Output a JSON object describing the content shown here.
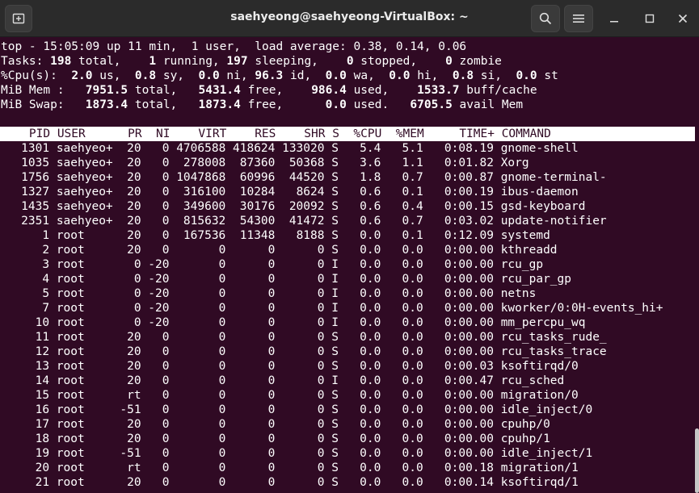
{
  "window": {
    "title": "saehyeong@saehyeong-VirtualBox: ~",
    "icons": {
      "new_tab": "new-tab-icon",
      "search": "search-icon",
      "menu": "hamburger-menu-icon",
      "minimize": "minimize-icon",
      "maximize": "maximize-icon",
      "close": "close-icon"
    }
  },
  "summary": {
    "line1": "top - 15:05:09 up 11 min,  1 user,  load average: 0.38, 0.14, 0.06",
    "tasks": {
      "label": "Tasks:",
      "total": "198",
      "running": "1",
      "sleeping": "197",
      "stopped": "0",
      "zombie": "0"
    },
    "cpu": {
      "label": "%Cpu(s):",
      "us": "2.0",
      "sy": "0.8",
      "ni": "0.0",
      "id": "96.3",
      "wa": "0.0",
      "hi": "0.0",
      "si": "0.8",
      "st": "0.0"
    },
    "mem": {
      "label": "MiB Mem :",
      "total": "7951.5",
      "free": "5431.4",
      "used": "986.4",
      "buff_cache": "1533.7"
    },
    "swap": {
      "label": "MiB Swap:",
      "total": "1873.4",
      "free": "1873.4",
      "used": "0.0",
      "avail": "6705.5"
    }
  },
  "table": {
    "headers": [
      "PID",
      "USER",
      "PR",
      "NI",
      "VIRT",
      "RES",
      "SHR",
      "S",
      "%CPU",
      "%MEM",
      "TIME+",
      "COMMAND"
    ],
    "rows": [
      [
        "1301",
        "saehyeo+",
        "20",
        "0",
        "4706588",
        "418624",
        "133020",
        "S",
        "5.4",
        "5.1",
        "0:08.19",
        "gnome-shell"
      ],
      [
        "1035",
        "saehyeo+",
        "20",
        "0",
        "278008",
        "87360",
        "50368",
        "S",
        "3.6",
        "1.1",
        "0:01.82",
        "Xorg"
      ],
      [
        "1756",
        "saehyeo+",
        "20",
        "0",
        "1047868",
        "60996",
        "44520",
        "S",
        "1.8",
        "0.7",
        "0:00.87",
        "gnome-terminal-"
      ],
      [
        "1327",
        "saehyeo+",
        "20",
        "0",
        "316100",
        "10284",
        "8624",
        "S",
        "0.6",
        "0.1",
        "0:00.19",
        "ibus-daemon"
      ],
      [
        "1435",
        "saehyeo+",
        "20",
        "0",
        "349600",
        "30176",
        "20092",
        "S",
        "0.6",
        "0.4",
        "0:00.15",
        "gsd-keyboard"
      ],
      [
        "2351",
        "saehyeo+",
        "20",
        "0",
        "815632",
        "54300",
        "41472",
        "S",
        "0.6",
        "0.7",
        "0:03.02",
        "update-notifier"
      ],
      [
        "1",
        "root",
        "20",
        "0",
        "167536",
        "11348",
        "8188",
        "S",
        "0.0",
        "0.1",
        "0:12.09",
        "systemd"
      ],
      [
        "2",
        "root",
        "20",
        "0",
        "0",
        "0",
        "0",
        "S",
        "0.0",
        "0.0",
        "0:00.00",
        "kthreadd"
      ],
      [
        "3",
        "root",
        "0",
        "-20",
        "0",
        "0",
        "0",
        "I",
        "0.0",
        "0.0",
        "0:00.00",
        "rcu_gp"
      ],
      [
        "4",
        "root",
        "0",
        "-20",
        "0",
        "0",
        "0",
        "I",
        "0.0",
        "0.0",
        "0:00.00",
        "rcu_par_gp"
      ],
      [
        "5",
        "root",
        "0",
        "-20",
        "0",
        "0",
        "0",
        "I",
        "0.0",
        "0.0",
        "0:00.00",
        "netns"
      ],
      [
        "7",
        "root",
        "0",
        "-20",
        "0",
        "0",
        "0",
        "I",
        "0.0",
        "0.0",
        "0:00.00",
        "kworker/0:0H-events_hi+"
      ],
      [
        "10",
        "root",
        "0",
        "-20",
        "0",
        "0",
        "0",
        "I",
        "0.0",
        "0.0",
        "0:00.00",
        "mm_percpu_wq"
      ],
      [
        "11",
        "root",
        "20",
        "0",
        "0",
        "0",
        "0",
        "S",
        "0.0",
        "0.0",
        "0:00.00",
        "rcu_tasks_rude_"
      ],
      [
        "12",
        "root",
        "20",
        "0",
        "0",
        "0",
        "0",
        "S",
        "0.0",
        "0.0",
        "0:00.00",
        "rcu_tasks_trace"
      ],
      [
        "13",
        "root",
        "20",
        "0",
        "0",
        "0",
        "0",
        "S",
        "0.0",
        "0.0",
        "0:00.03",
        "ksoftirqd/0"
      ],
      [
        "14",
        "root",
        "20",
        "0",
        "0",
        "0",
        "0",
        "I",
        "0.0",
        "0.0",
        "0:00.47",
        "rcu_sched"
      ],
      [
        "15",
        "root",
        "rt",
        "0",
        "0",
        "0",
        "0",
        "S",
        "0.0",
        "0.0",
        "0:00.00",
        "migration/0"
      ],
      [
        "16",
        "root",
        "-51",
        "0",
        "0",
        "0",
        "0",
        "S",
        "0.0",
        "0.0",
        "0:00.00",
        "idle_inject/0"
      ],
      [
        "17",
        "root",
        "20",
        "0",
        "0",
        "0",
        "0",
        "S",
        "0.0",
        "0.0",
        "0:00.00",
        "cpuhp/0"
      ],
      [
        "18",
        "root",
        "20",
        "0",
        "0",
        "0",
        "0",
        "S",
        "0.0",
        "0.0",
        "0:00.00",
        "cpuhp/1"
      ],
      [
        "19",
        "root",
        "-51",
        "0",
        "0",
        "0",
        "0",
        "S",
        "0.0",
        "0.0",
        "0:00.00",
        "idle_inject/1"
      ],
      [
        "20",
        "root",
        "rt",
        "0",
        "0",
        "0",
        "0",
        "S",
        "0.0",
        "0.0",
        "0:00.18",
        "migration/1"
      ],
      [
        "21",
        "root",
        "20",
        "0",
        "0",
        "0",
        "0",
        "S",
        "0.0",
        "0.0",
        "0:00.14",
        "ksoftirqd/1"
      ]
    ]
  }
}
